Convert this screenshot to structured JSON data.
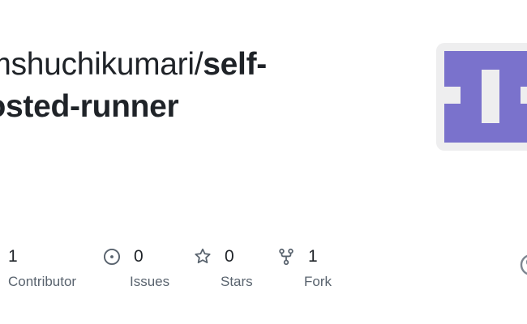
{
  "repo": {
    "owner": "amshuchikumari",
    "separator": "/",
    "name_line1": "self-",
    "name_line2": "hosted-runner"
  },
  "stats": {
    "contributors": {
      "count": "1",
      "label": "Contributor",
      "icon": "people-icon"
    },
    "issues": {
      "count": "0",
      "label": "Issues",
      "icon": "issue-opened-icon"
    },
    "stars": {
      "count": "0",
      "label": "Stars",
      "icon": "star-icon"
    },
    "forks": {
      "count": "1",
      "label": "Fork",
      "icon": "repo-forked-icon"
    }
  },
  "colors": {
    "avatar_primary": "#7a72cc",
    "avatar_background": "#eeeeef",
    "text": "#1f2328",
    "muted_text": "#59636e",
    "icon": "#59636e"
  }
}
